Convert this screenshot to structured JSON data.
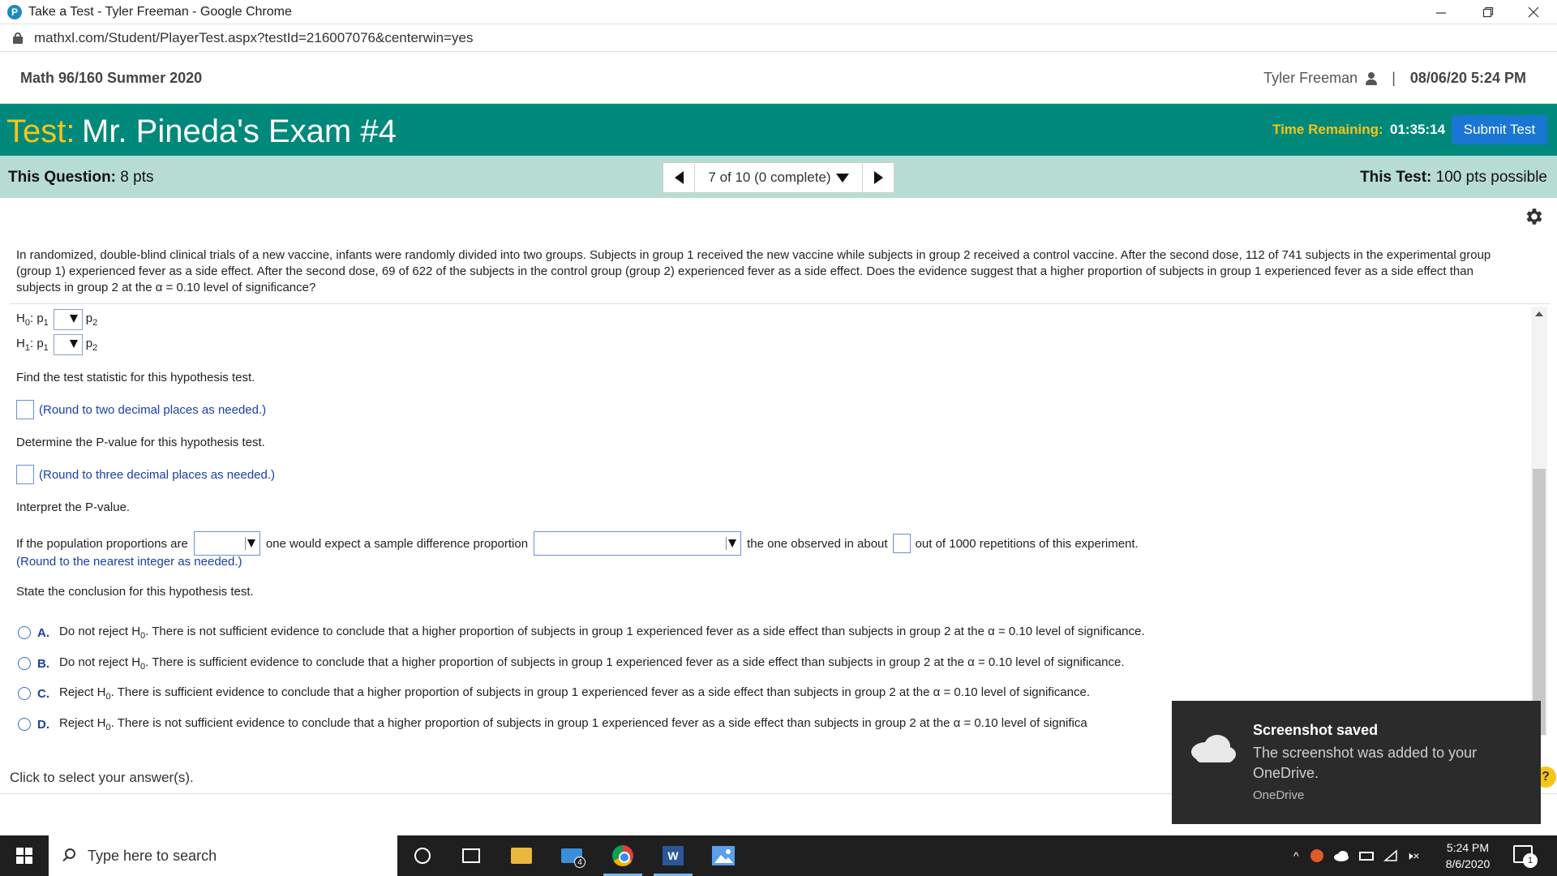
{
  "window": {
    "title": "Take a Test - Tyler Freeman - Google Chrome",
    "url": "mathxl.com/Student/PlayerTest.aspx?testId=216007076&centerwin=yes",
    "favicon_letter": "P"
  },
  "course": {
    "title": "Math 96/160 Summer 2020",
    "user": "Tyler Freeman",
    "separator": "|",
    "datetime": "08/06/20 5:24 PM"
  },
  "test": {
    "label": "Test:",
    "name": "Mr. Pineda's Exam #4",
    "time_label": "Time Remaining:",
    "time_value": "01:35:14",
    "submit_label": "Submit Test"
  },
  "question_bar": {
    "this_question_label": "This Question:",
    "this_question_value": "8 pts",
    "progress": "7 of 10 (0 complete)",
    "this_test_label": "This Test:",
    "this_test_value": "100 pts possible"
  },
  "question": {
    "text": "In randomized, double-blind clinical trials of a new vaccine, infants were randomly divided into two groups. Subjects in group 1 received the new vaccine while subjects in group 2 received a control vaccine. After the second dose, 112 of 741 subjects in the experimental group (group 1) experienced fever as a side effect. After the second dose, 69 of 622 of the subjects in the control group (group 2) experienced fever as a side effect. Does the evidence suggest that a higher proportion of subjects in group 1 experienced fever as a side effect than subjects in group 2 at the α = 0.10 level of significance?",
    "h0": {
      "h": "H",
      "sub": "0",
      "p1": "p",
      "p1sub": "1",
      "p2": "p",
      "p2sub": "2",
      "colon": ":"
    },
    "h1": {
      "h": "H",
      "sub": "1",
      "p1": "p",
      "p1sub": "1",
      "p2": "p",
      "p2sub": "2",
      "colon": ":"
    },
    "find_stat": "Find the test statistic for this hypothesis test.",
    "round_two": "(Round to two decimal places as needed.)",
    "find_p": "Determine the P-value for this hypothesis test.",
    "round_three": "(Round to three decimal places as needed.)",
    "interpret": "Interpret the P-value.",
    "interp_1": "If the population proportions are",
    "interp_2": "one would expect a sample difference proportion",
    "interp_3": "the one observed in about",
    "interp_4": "out of 1000 repetitions of this experiment.",
    "round_int": "(Round to the nearest integer as needed.)",
    "conclusion": "State the conclusion for this hypothesis test.",
    "options": [
      {
        "letter": "A.",
        "pre": "Do not reject H",
        "sub": "0",
        "text": ". There is not sufficient evidence to conclude that a higher proportion of subjects in group 1 experienced fever as a side effect than subjects in group 2 at the α = 0.10 level of significance."
      },
      {
        "letter": "B.",
        "pre": "Do not reject H",
        "sub": "0",
        "text": ". There is sufficient evidence to conclude that a higher proportion of subjects in group 1 experienced fever as a side effect than subjects in group 2 at the α = 0.10 level of significance."
      },
      {
        "letter": "C.",
        "pre": "Reject H",
        "sub": "0",
        "text": ". There is sufficient evidence to conclude that a higher proportion of subjects in group 1 experienced fever as a side effect than subjects in group 2 at the α = 0.10 level of significance."
      },
      {
        "letter": "D.",
        "pre": "Reject H",
        "sub": "0",
        "text": ". There is not sufficient evidence to conclude that a higher proportion of subjects in group 1 experienced fever as a side effect than subjects in group 2 at the α = 0.10 level of significa"
      }
    ],
    "click_note": "Click to select your answer(s)."
  },
  "toast": {
    "title": "Screenshot saved",
    "body": "The screenshot was added to your OneDrive.",
    "source": "OneDrive"
  },
  "help_badge": "?",
  "taskbar": {
    "search_placeholder": "Type here to search",
    "mail_badge": "4",
    "word_letter": "W",
    "time": "5:24 PM",
    "date": "8/6/2020",
    "notification_count": "1",
    "tray_chevron": "^",
    "volume": "🕨×"
  },
  "colors": {
    "banner": "#00897b",
    "accent_yellow": "#f5c518",
    "info_bar": "#b7dcd3",
    "submit": "#1976d2",
    "link_blue": "#1a3fa5"
  }
}
